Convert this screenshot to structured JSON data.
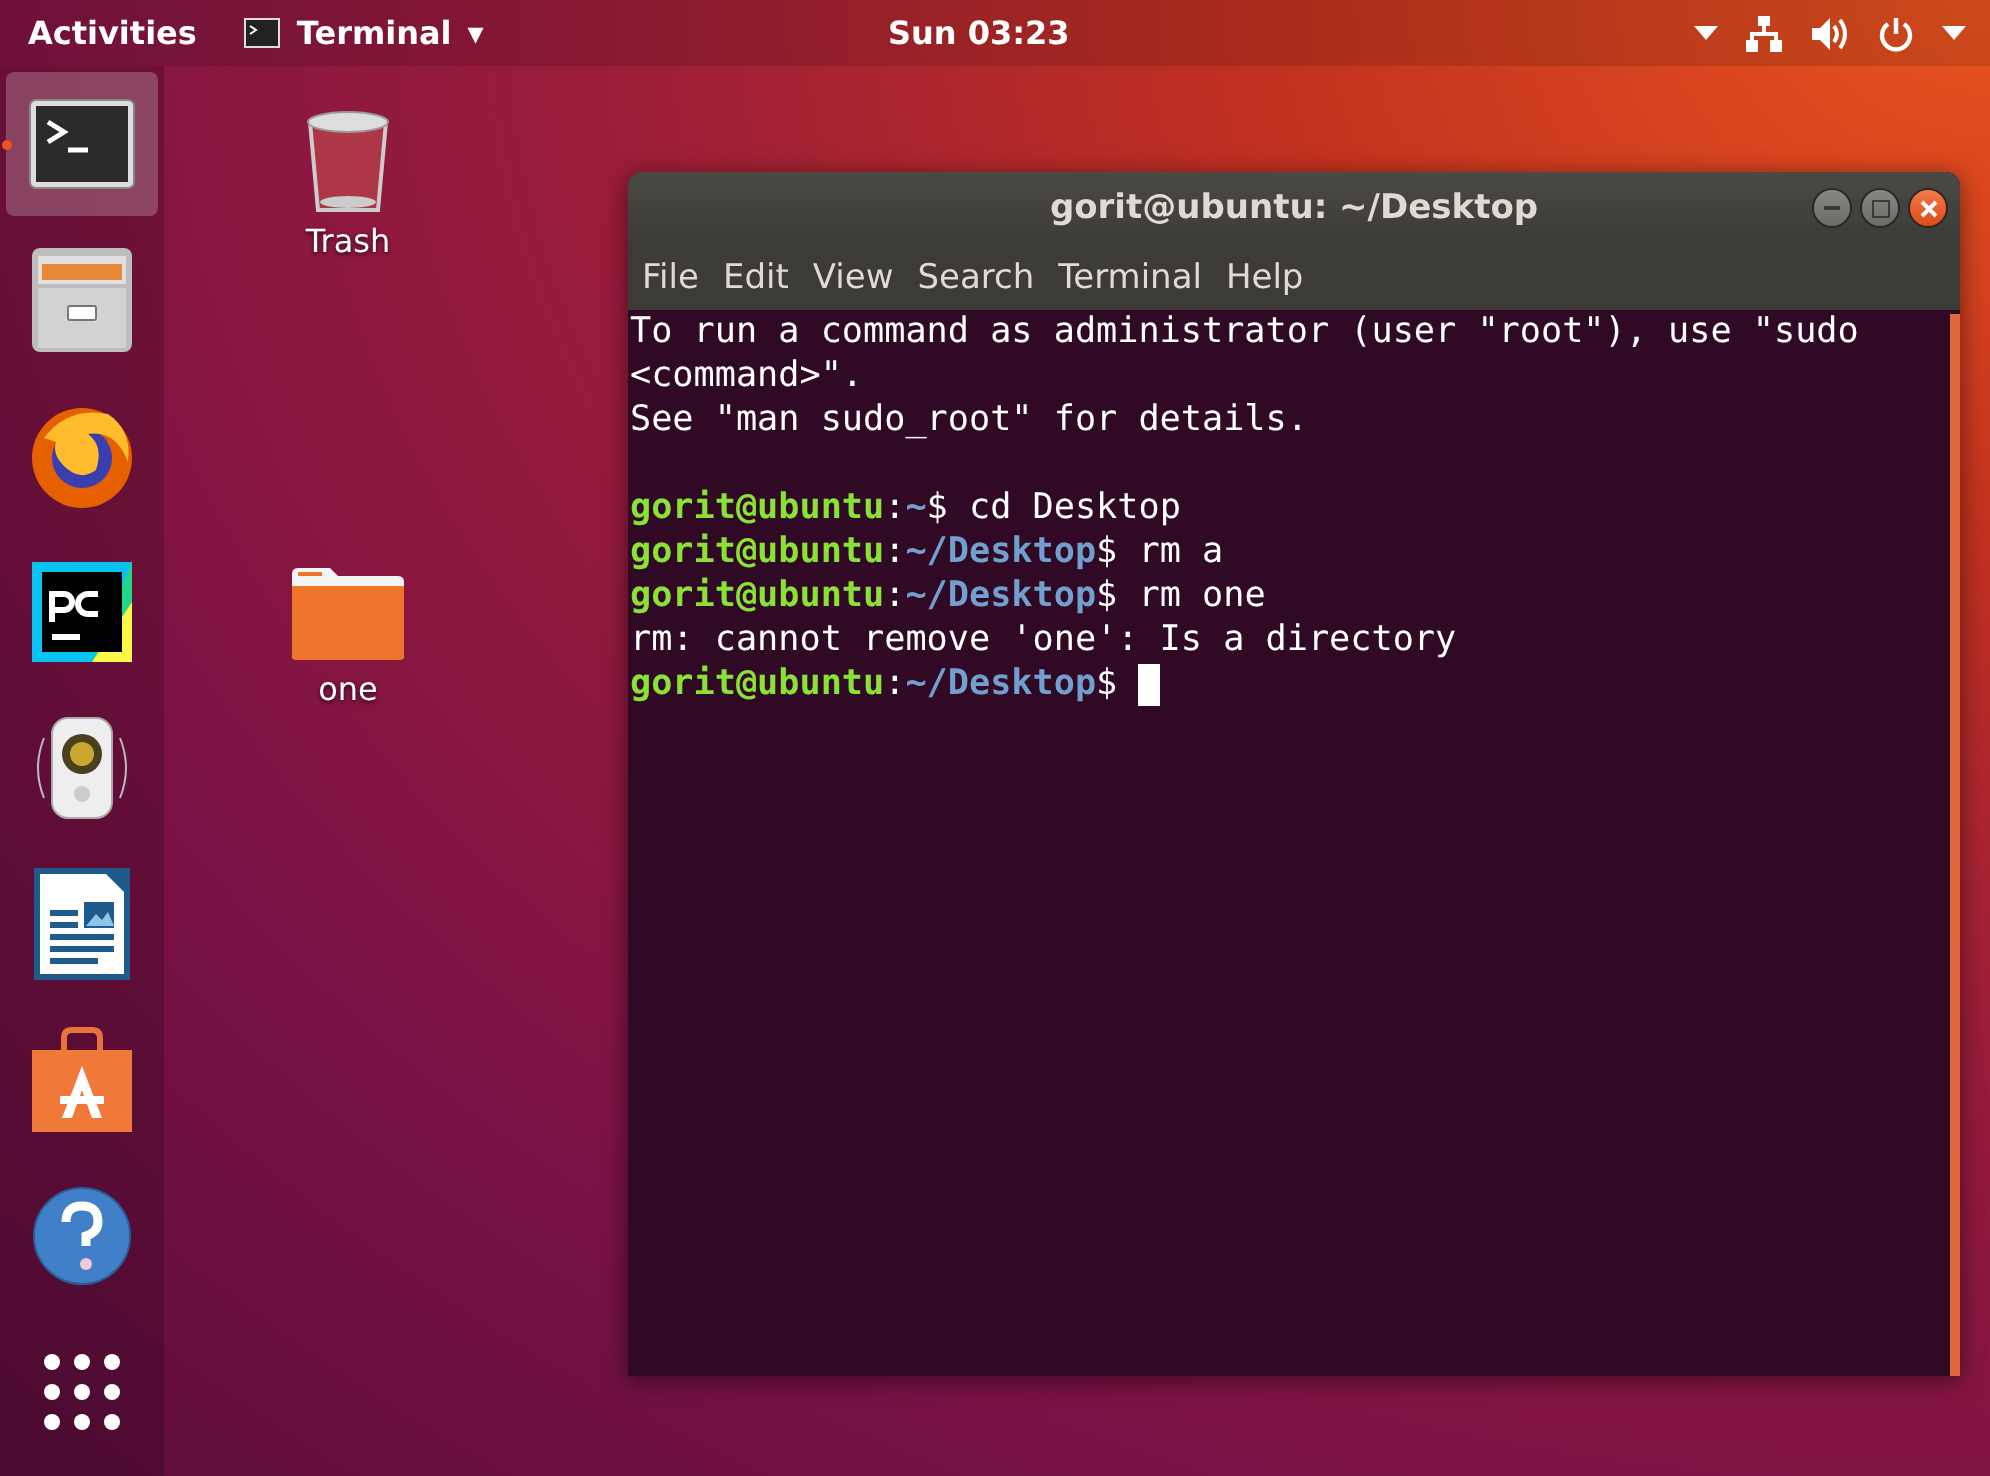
{
  "top_bar": {
    "activities": "Activities",
    "app_menu": {
      "label": "Terminal",
      "caret": "▾"
    },
    "clock": "Sun 03:23",
    "tray": [
      {
        "kind": "caret"
      },
      {
        "kind": "network"
      },
      {
        "kind": "volume"
      },
      {
        "kind": "power"
      },
      {
        "kind": "caret"
      }
    ]
  },
  "dock": {
    "items": [
      {
        "kind": "terminal",
        "selected": true,
        "running": true
      },
      {
        "kind": "files",
        "selected": false,
        "running": false
      },
      {
        "kind": "browser",
        "selected": false,
        "running": false
      },
      {
        "kind": "ide",
        "selected": false,
        "running": false
      },
      {
        "kind": "music",
        "selected": false,
        "running": false
      },
      {
        "kind": "writer",
        "selected": false,
        "running": false
      },
      {
        "kind": "software",
        "selected": false,
        "running": false
      },
      {
        "kind": "help",
        "selected": false,
        "running": false
      },
      {
        "kind": "apps",
        "selected": false,
        "running": false
      }
    ]
  },
  "desktop_icons": [
    {
      "kind": "trash",
      "label": "Trash"
    },
    {
      "kind": "folder",
      "label": "one"
    }
  ],
  "terminal_window": {
    "title": "gorit@ubuntu: ~/Desktop",
    "menu": [
      "File",
      "Edit",
      "View",
      "Search",
      "Terminal",
      "Help"
    ],
    "lines": [
      {
        "kind": "output",
        "text": "To run a command as administrator (user \"root\"), use \"sudo"
      },
      {
        "kind": "output",
        "text": "<command>\"."
      },
      {
        "kind": "output",
        "text": "See \"man sudo_root\" for details."
      },
      {
        "kind": "blank"
      },
      {
        "kind": "prompt",
        "user": "gorit@ubuntu",
        "separator": ":",
        "path": "~",
        "command": "$ cd Desktop"
      },
      {
        "kind": "prompt",
        "user": "gorit@ubuntu",
        "separator": ":",
        "path": "~/Desktop",
        "command": "$ rm a"
      },
      {
        "kind": "prompt",
        "user": "gorit@ubuntu",
        "separator": ":",
        "path": "~/Desktop",
        "command": "$ rm one"
      },
      {
        "kind": "output",
        "text": "rm: cannot remove 'one': Is a directory"
      },
      {
        "kind": "prompt",
        "user": "gorit@ubuntu",
        "separator": ":",
        "path": "~/Desktop",
        "command": "$ ",
        "cursor": true
      }
    ]
  }
}
